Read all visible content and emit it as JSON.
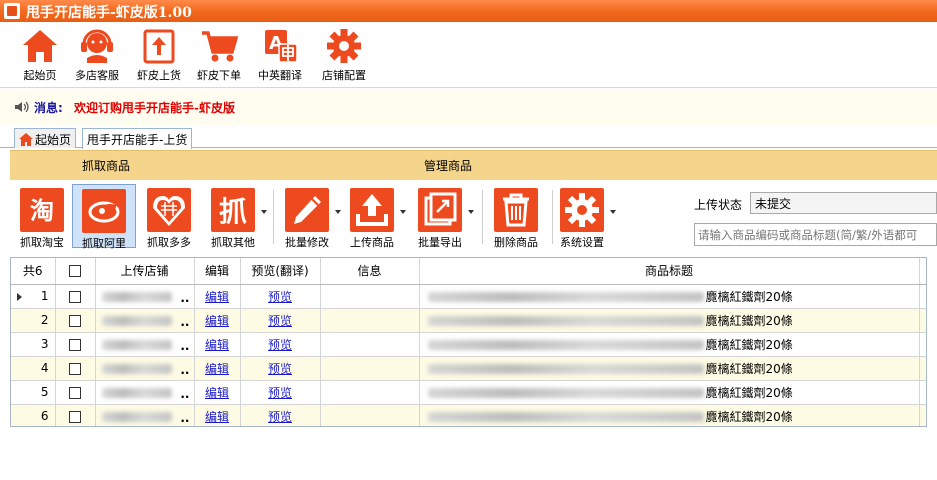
{
  "window": {
    "title": "甩手开店能手-虾皮版1.00"
  },
  "toolbar": {
    "items": [
      {
        "label": "起始页",
        "icon": "home-icon"
      },
      {
        "label": "多店客服",
        "icon": "headset-icon"
      },
      {
        "label": "虾皮上货",
        "icon": "upload-box-icon"
      },
      {
        "label": "虾皮下单",
        "icon": "cart-icon"
      },
      {
        "label": "中英翻译",
        "icon": "translate-icon"
      },
      {
        "label": "店铺配置",
        "icon": "gear-icon"
      }
    ]
  },
  "message": {
    "label": "消息:",
    "text": "欢迎订购甩手开店能手-虾皮版"
  },
  "tabs": [
    {
      "label": "起始页",
      "active": false
    },
    {
      "label": "甩手开店能手-上货",
      "active": true
    }
  ],
  "sections": {
    "fetch": "抓取商品",
    "manage": "管理商品"
  },
  "actions": [
    {
      "label": "抓取淘宝",
      "icon": "taobao-icon"
    },
    {
      "label": "抓取阿里",
      "icon": "alibaba-icon",
      "selected": true
    },
    {
      "label": "抓取多多",
      "icon": "pinduoduo-icon"
    },
    {
      "label": "抓取其他",
      "icon": "grab-icon",
      "dropdown": true
    },
    {
      "label": "批量修改",
      "icon": "pencil-icon",
      "dropdown": true
    },
    {
      "label": "上传商品",
      "icon": "upload-icon",
      "dropdown": true
    },
    {
      "label": "批量导出",
      "icon": "export-icon",
      "dropdown": true
    },
    {
      "label": "删除商品",
      "icon": "trash-icon"
    },
    {
      "label": "系统设置",
      "icon": "gear-icon",
      "dropdown": true
    }
  ],
  "filters": {
    "upload_status_label": "上传状态",
    "upload_status_value": "未提交",
    "search_placeholder": "请输入商品编码或商品标题(简/繁/外语都可"
  },
  "grid": {
    "headers": {
      "count": "共6",
      "store": "上传店铺",
      "edit": "编辑",
      "preview": "预览(翻译)",
      "info": "信息",
      "title": "商品标题"
    },
    "rows": [
      {
        "num": "1",
        "store_tail": "..",
        "edit": "编辑",
        "preview": "预览",
        "title_tail": "麑樆紅鐵劑20條",
        "current": true
      },
      {
        "num": "2",
        "store_tail": "..",
        "edit": "编辑",
        "preview": "预览",
        "title_tail": "麑樆紅鐵劑20條"
      },
      {
        "num": "3",
        "store_tail": "..",
        "edit": "编辑",
        "preview": "预览",
        "title_tail": "麑樆紅鐵劑20條"
      },
      {
        "num": "4",
        "store_tail": "..",
        "edit": "编辑",
        "preview": "预览",
        "title_tail": "麑樆紅鐵劑20條"
      },
      {
        "num": "5",
        "store_tail": "..",
        "edit": "编辑",
        "preview": "预览",
        "title_tail": "麑樆紅鐵劑20條"
      },
      {
        "num": "6",
        "store_tail": "..",
        "edit": "编辑",
        "preview": "预览",
        "title_tail": "麑樆紅鐵劑20條"
      }
    ]
  },
  "colors": {
    "accent": "#ee4a1f",
    "titlebar": "#f26a1f",
    "section_bar": "#f5d48b",
    "row_alt": "#fdfbe3",
    "link": "#1a1acc",
    "message": "#e00000"
  }
}
